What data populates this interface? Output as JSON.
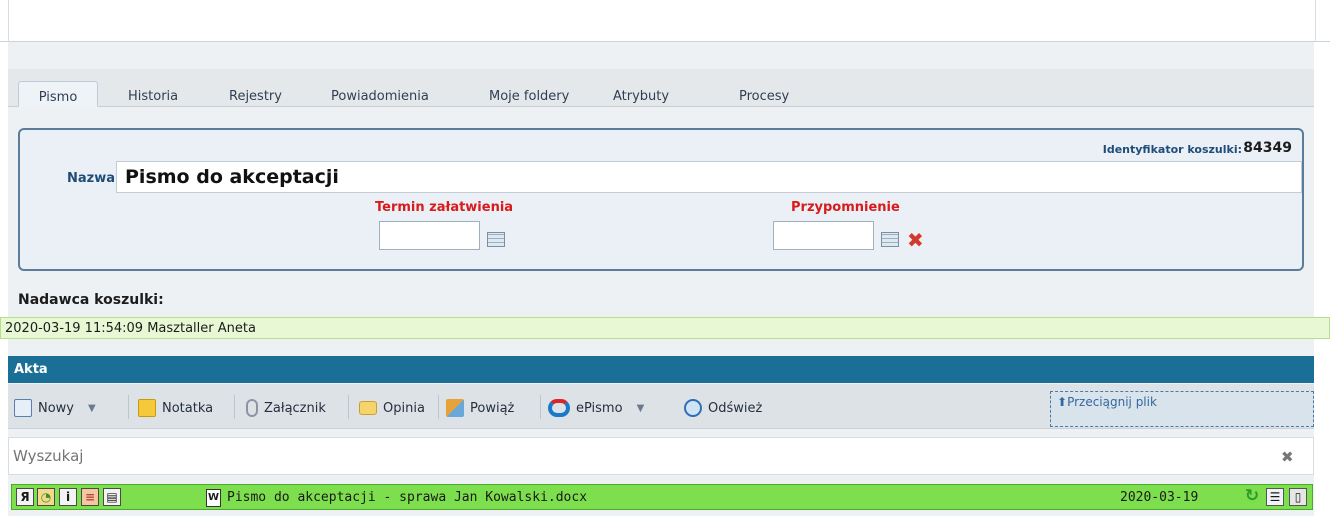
{
  "tabs": [
    {
      "label": "Pismo",
      "active": true
    },
    {
      "label": "Historia",
      "active": false
    },
    {
      "label": "Rejestry",
      "active": false
    },
    {
      "label": "Powiadomienia",
      "active": false
    },
    {
      "label": "Moje foldery",
      "active": false
    },
    {
      "label": "Atrybuty",
      "active": false
    },
    {
      "label": "Procesy",
      "active": false
    }
  ],
  "form": {
    "id_label": "Identyfikator koszulki:",
    "id_value": "84349",
    "name_label": "Nazwa",
    "name_value": "Pismo do akceptacji",
    "due_label": "Termin załatwienia",
    "due_value": "",
    "reminder_label": "Przypomnienie",
    "reminder_value": ""
  },
  "sender": {
    "label": "Nadawca koszulki:",
    "entry": "2020-03-19 11:54:09   Masztaller Aneta"
  },
  "akta": {
    "title": "Akta",
    "toolbar": {
      "new": "Nowy",
      "note": "Notatka",
      "attachment": "Załącznik",
      "opinion": "Opinia",
      "link": "Powiąż",
      "epismo": "ePismo",
      "refresh": "Odśwież"
    },
    "dropzone": "Przeciągnij plik",
    "search_placeholder": "Wyszukaj",
    "document": {
      "name": "Pismo do akceptacji - sprawa Jan Kowalski.docx",
      "date": "2020-03-19"
    }
  },
  "colors": {
    "accent": "#1a6f97",
    "label_red": "#d81b1b",
    "row_green": "#7ddf4d",
    "label_blue": "#1f4d78"
  }
}
